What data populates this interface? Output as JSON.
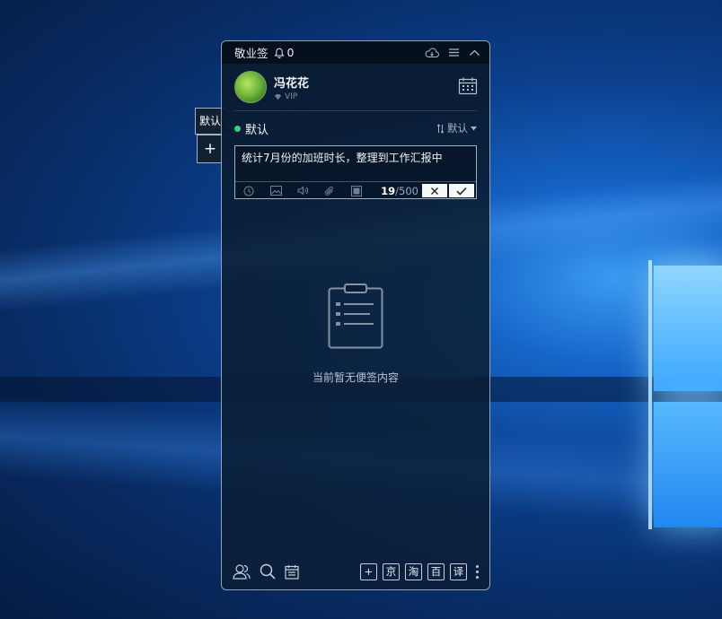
{
  "app": {
    "title": "敬业签",
    "notification_count": "0"
  },
  "side_tabs": {
    "category_tab": "默认",
    "add_tab": "+"
  },
  "user": {
    "name": "冯花花",
    "badge": "VIP"
  },
  "category": {
    "name": "默认",
    "status_color": "#36d17a",
    "sort_label": "默认",
    "sort_icon": "sort-arrows-icon"
  },
  "editor": {
    "text": "统计7月份的加班时长，整理到工作汇报中",
    "char_count": "19",
    "char_limit": "/500",
    "tools": [
      "clock-icon",
      "image-icon",
      "audio-icon",
      "attachment-icon",
      "color-icon"
    ]
  },
  "empty_state": {
    "icon": "clipboard-icon",
    "message": "当前暂无便签内容"
  },
  "bottom": {
    "left_icons": [
      "contacts-icon",
      "search-icon",
      "calendar-icon"
    ],
    "shortcuts": [
      "+",
      "京",
      "淘",
      "百",
      "译"
    ]
  }
}
